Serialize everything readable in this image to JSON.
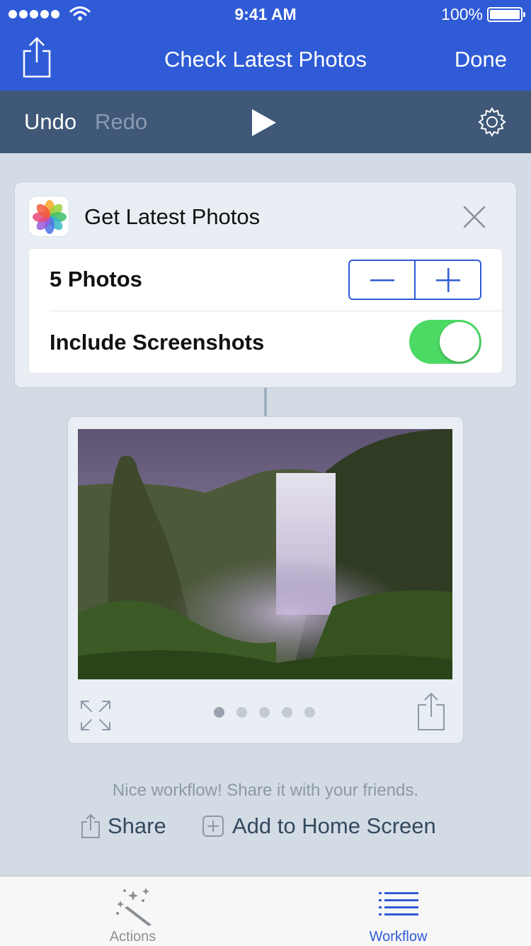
{
  "status": {
    "time": "9:41 AM",
    "battery": "100%"
  },
  "nav": {
    "title": "Check Latest Photos",
    "done_label": "Done"
  },
  "toolbar": {
    "undo_label": "Undo",
    "redo_label": "Redo"
  },
  "action": {
    "title": "Get Latest Photos",
    "photos_label": "5 Photos",
    "photos_count": 5,
    "include_screenshots_label": "Include Screenshots",
    "include_screenshots": true
  },
  "preview": {
    "pages": 5,
    "current_page": 1
  },
  "footer": {
    "message": "Nice workflow! Share it with your friends.",
    "share_label": "Share",
    "home_label": "Add to Home Screen"
  },
  "tabs": [
    {
      "label": "Actions",
      "active": false
    },
    {
      "label": "Workflow",
      "active": true
    }
  ],
  "colors": {
    "accent": "#2f5bd6",
    "toolbar": "#3f5878",
    "toggle_on": "#4cd964",
    "background": "#d3dbe5"
  }
}
